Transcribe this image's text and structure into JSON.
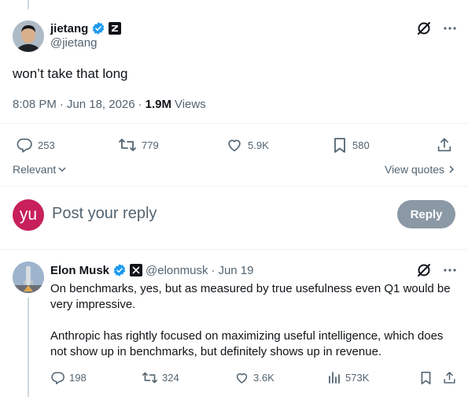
{
  "tweet": {
    "display_name": "jietang",
    "handle": "@jietang",
    "text": "won’t take that long",
    "time": "8:08 PM",
    "date": "Jun 18, 2026",
    "views_count": "1.9M",
    "views_label": "Views",
    "stats": {
      "replies": "253",
      "reposts": "779",
      "likes": "5.9K",
      "bookmarks": "580"
    }
  },
  "sort": {
    "label": "Relevant"
  },
  "quotes_link": {
    "label": "View quotes"
  },
  "composer": {
    "avatar_text": "yu",
    "placeholder": "Post your reply",
    "reply_button": "Reply"
  },
  "reply_tweet": {
    "display_name": "Elon Musk",
    "handle": "@elonmusk",
    "date": "Jun 19",
    "paragraph_1": "On benchmarks, yes, but as measured by true usefulness even Q1 would be very impressive.",
    "paragraph_2": "Anthropic has rightly focused on maximizing useful intelligence, which does not show up in benchmarks, but definitely shows up in revenue.",
    "stats": {
      "replies": "198",
      "reposts": "324",
      "likes": "3.6K",
      "views": "573K"
    }
  },
  "icons": {
    "verified": "verified-badge-icon",
    "affiliate": "affiliate-z-badge-icon",
    "grok": "grok-icon",
    "more": "more-icon",
    "reply": "reply-icon",
    "repost": "repost-icon",
    "like": "like-icon",
    "bookmark": "bookmark-icon",
    "share": "share-icon",
    "views": "views-icon"
  },
  "colors": {
    "verified": "#1d9bf0",
    "text": "#0f1419",
    "muted": "#536471",
    "reply_avatar": "#c7205a",
    "reply_button_disabled": "#8b98a5"
  }
}
